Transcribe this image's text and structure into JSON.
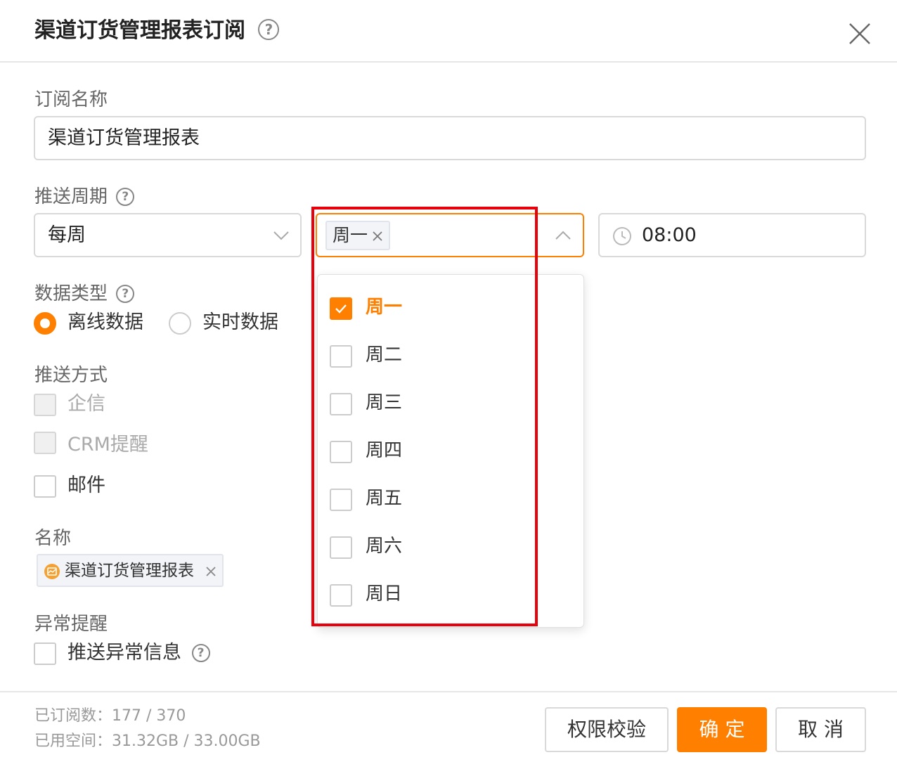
{
  "dialog": {
    "title": "渠道订货管理报表订阅",
    "help_glyph": "?"
  },
  "form": {
    "subscription_name_label": "订阅名称",
    "subscription_name_value": "渠道订货管理报表",
    "push_cycle_label": "推送周期",
    "push_cycle_value": "每周",
    "selected_day_tag": "周一",
    "time_value": "08:00",
    "data_type_label": "数据类型",
    "data_type_options": [
      {
        "label": "离线数据",
        "selected": true
      },
      {
        "label": "实时数据",
        "selected": false
      }
    ],
    "push_method_label": "推送方式",
    "push_methods": [
      {
        "label": "企信",
        "checked": false,
        "disabled": true
      },
      {
        "label": "CRM提醒",
        "checked": false,
        "disabled": true
      },
      {
        "label": "邮件",
        "checked": false,
        "disabled": false
      }
    ],
    "name_label": "名称",
    "name_tag": "渠道订货管理报表",
    "alert_label": "异常提醒",
    "alert_option": "推送异常信息"
  },
  "dropdown": {
    "options": [
      {
        "label": "周一",
        "checked": true
      },
      {
        "label": "周二",
        "checked": false
      },
      {
        "label": "周三",
        "checked": false
      },
      {
        "label": "周四",
        "checked": false
      },
      {
        "label": "周五",
        "checked": false
      },
      {
        "label": "周六",
        "checked": false
      },
      {
        "label": "周日",
        "checked": false
      }
    ]
  },
  "footer": {
    "subscribed_count": "已订阅数：177 / 370",
    "used_space": "已用空间：31.32GB / 33.00GB",
    "verify_button": "权限校验",
    "confirm_button": "确 定",
    "cancel_button": "取 消"
  },
  "colors": {
    "accent": "#ff8000",
    "highlight_border": "#e8000b"
  }
}
